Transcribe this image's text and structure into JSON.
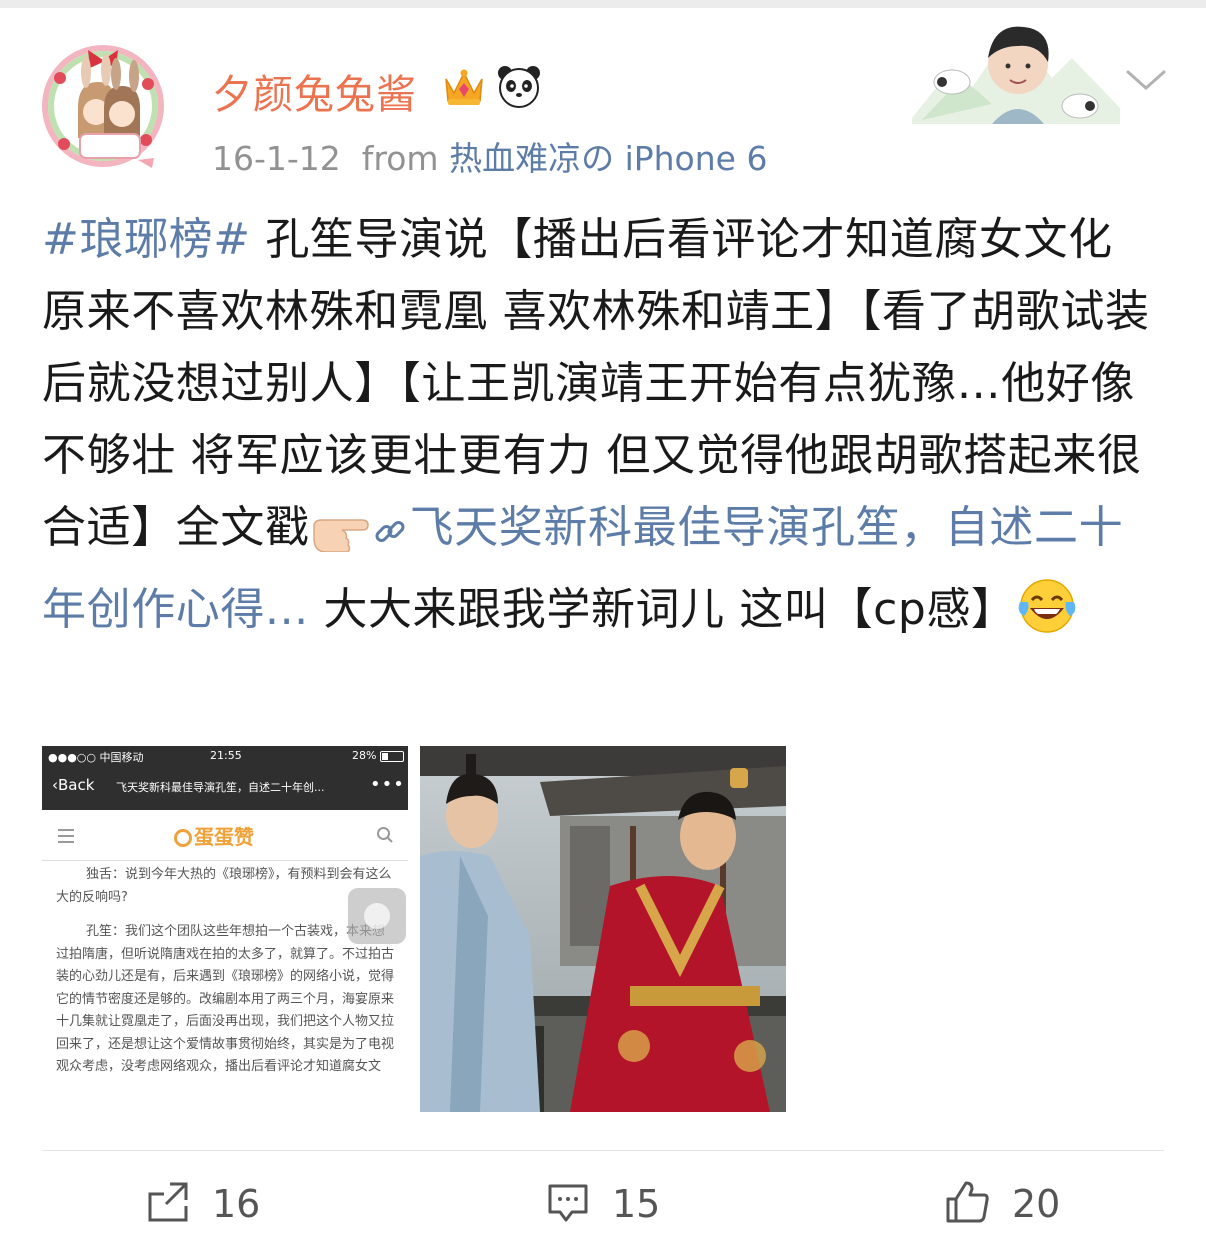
{
  "post": {
    "username": "夕颜兔兔酱",
    "date": "16-1-12",
    "source_prefix": "from",
    "source": "热血难凉の iPhone 6",
    "text": {
      "hashtag": "#琅琊榜#",
      "part1": " 孔笙导演说【播出后看评论才知道腐女文化 原来不喜欢林殊和霓凰 喜欢林殊和靖王】【看了胡歌试装后就没想过别人】【让王凯演靖王开始有点犹豫…他好像不够壮 将军应该更壮更有力 但又觉得他跟胡歌搭起来很合适】全文戳",
      "link": "飞天奖新科最佳导演孔笙，自述二十年创作心得...",
      "part2": " 大大来跟我学新词儿 这叫【cp感】"
    }
  },
  "screenshot": {
    "carrier": "●●●○○ 中国移动",
    "time": "21:55",
    "battery": "28%",
    "back": "Back",
    "title": "飞天奖新科最佳导演孔笙，自述二十年创...",
    "more": "•••",
    "logo": "蛋蛋赞",
    "para1": "独舌：说到今年大热的《琅琊榜》，有预料到会有这么大的反响吗?",
    "para2": "孔笙：我们这个团队这些年想拍一个古装戏，本来想过拍隋唐，但听说隋唐戏在拍的太多了，就算了。不过拍古装的心劲儿还是有，后来遇到《琅琊榜》的网络小说，觉得它的情节密度还是够的。改编剧本用了两三个月，海宴原来十几集就让霓凰走了，后面没再出现，我们把这个人物又拉回来了，还是想让这个爱情故事贯彻始终，其实是为了电视观众考虑，没考虑网络观众，播出后看评论才知道腐女文"
  },
  "footer": {
    "repost_count": "16",
    "comment_count": "15",
    "like_count": "20"
  },
  "colors": {
    "username": "#eb7350",
    "link": "#5d7da8",
    "meta": "#929292"
  },
  "icons": [
    "crown-badge-icon",
    "panda-badge-icon",
    "chevron-down-icon",
    "pointing-hand-emoji",
    "link-icon",
    "laughing-emoji",
    "repost-icon",
    "comment-icon",
    "like-icon"
  ]
}
